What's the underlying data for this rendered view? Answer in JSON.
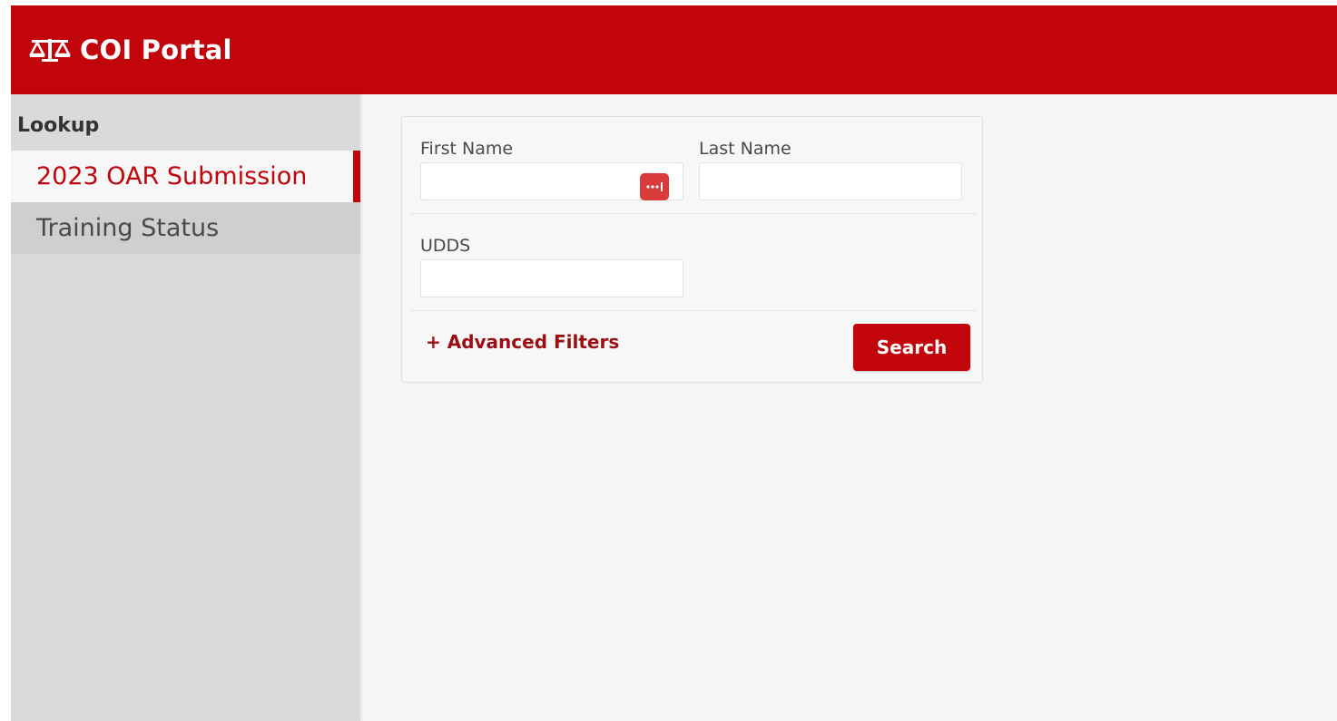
{
  "header": {
    "title": "COI Portal",
    "logo_icon": "balance-scale-icon",
    "background_color": "#c2050b"
  },
  "sidebar": {
    "section_label": "Lookup",
    "items": [
      {
        "label": "2023 OAR Submission",
        "active": true
      },
      {
        "label": "Training Status",
        "active": false
      }
    ]
  },
  "search_form": {
    "fields": {
      "first_name": {
        "label": "First Name",
        "value": "",
        "placeholder": ""
      },
      "last_name": {
        "label": "Last Name",
        "value": "",
        "placeholder": ""
      },
      "udds": {
        "label": "UDDS",
        "value": "",
        "placeholder": ""
      }
    },
    "password_manager_icon": "password-manager-icon",
    "advanced_filters_label": "+ Advanced Filters",
    "search_button_label": "Search"
  },
  "colors": {
    "accent": "#c2050b",
    "link": "#9b0e13",
    "sidebar_bg": "#dadada",
    "content_bg": "#f5f5f5"
  }
}
